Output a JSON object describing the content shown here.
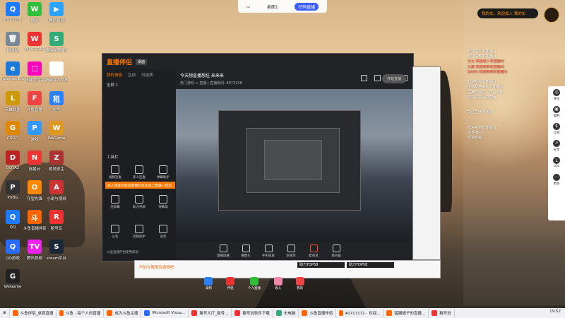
{
  "desktop": {
    "icons": [
      {
        "label": "8973158",
        "color": "#1e7bff",
        "glyph": "Q"
      },
      {
        "label": "微信",
        "color": "#2fbf3a",
        "glyph": "W"
      },
      {
        "label": "腾讯视频",
        "color": "#2ca3ff",
        "glyph": "▶"
      },
      {
        "label": "回收站",
        "color": "#7a8797",
        "glyph": "🗑"
      },
      {
        "label": "WPS 2019",
        "color": "#e33",
        "glyph": "W"
      },
      {
        "label": "搜狗视频输入法",
        "color": "#3a7",
        "glyph": "S"
      },
      {
        "label": "Internet Explorer",
        "color": "#1d7ad8",
        "glyph": "e"
      },
      {
        "label": "新建文件夹",
        "color": "#f0b",
        "glyph": "□"
      },
      {
        "label": "新建文本文档",
        "color": "#fff",
        "glyph": "≡"
      },
      {
        "label": "英雄联盟",
        "color": "#c90",
        "glyph": "L"
      },
      {
        "label": "斗鱼直播",
        "color": "#e44",
        "glyph": "F"
      },
      {
        "label": "租号",
        "color": "#2a80ff",
        "glyph": "租"
      },
      {
        "label": "CSGO",
        "color": "#d80",
        "glyph": "G"
      },
      {
        "label": "游戏",
        "color": "#39f",
        "glyph": "P"
      },
      {
        "label": "WeGame",
        "color": "#d92",
        "glyph": "W"
      },
      {
        "label": "DOTA2",
        "color": "#b22",
        "glyph": "D"
      },
      {
        "label": "网易云",
        "color": "#e33",
        "glyph": "N"
      },
      {
        "label": "绝地求生",
        "color": "#a33",
        "glyph": "Z"
      },
      {
        "label": "PUBG",
        "color": "#333",
        "glyph": "P"
      },
      {
        "label": "守望先锋",
        "color": "#f80",
        "glyph": "O"
      },
      {
        "label": "小说与视频",
        "color": "#c33",
        "glyph": "A"
      },
      {
        "label": "QQ",
        "color": "#1e7bff",
        "glyph": "Q"
      },
      {
        "label": "斗鱼直播伴侣",
        "color": "#f60",
        "glyph": "斗"
      },
      {
        "label": "租号玩",
        "color": "#e33",
        "glyph": "R"
      },
      {
        "label": "QQ游戏",
        "color": "#2a6cff",
        "glyph": "Q"
      },
      {
        "label": "腾讯视频",
        "color": "#e2e",
        "glyph": "TV"
      },
      {
        "label": "steam平台",
        "color": "#1b2838",
        "glyph": "S"
      },
      {
        "label": "WeGame",
        "color": "#222",
        "glyph": "G"
      }
    ]
  },
  "topbar": {
    "screen_label": "桌面1",
    "qr_label": "扫码直播"
  },
  "right_panel": {
    "header": "我的车，欢迎加入 我的车",
    "lines": [
      {
        "text": "欢迎进入本直播间",
        "red": false
      },
      {
        "text": "欢迎来到本直播间",
        "red": false
      },
      {
        "text": "七七 欢迎进入本直播间",
        "red": true
      },
      {
        "text": "九霄 欢迎来到本直播间",
        "red": true
      },
      {
        "text": "Smith 欢迎来到本直播间",
        "red": true
      },
      {
        "text": "",
        "red": false
      },
      {
        "text": "欢迎观看本直播间",
        "red": false
      },
      {
        "text": "主播欢迎来到本直播间",
        "red": false
      },
      {
        "text": "主播欢迎你，欢迎大家",
        "red": false
      },
      {
        "text": "欢迎你来我的直播",
        "red": false
      },
      {
        "text": "",
        "red": false
      },
      {
        "text": "",
        "red": false
      },
      {
        "text": "关注主播不迷路",
        "red": false
      },
      {
        "text": "",
        "red": false
      },
      {
        "text": "",
        "red": false
      },
      {
        "text": "欢迎来到本直播间",
        "red": false
      },
      {
        "text": "本直播间",
        "red": false
      },
      {
        "text": "欢迎观看",
        "red": false
      }
    ],
    "side": [
      {
        "label": "评论",
        "glyph": "◎"
      },
      {
        "label": "福利",
        "glyph": "▣"
      },
      {
        "label": "订阅",
        "glyph": "$"
      },
      {
        "label": "分享",
        "glyph": "↗"
      },
      {
        "label": "LOL",
        "glyph": "L"
      },
      {
        "label": "更多",
        "glyph": "⋯"
      }
    ]
  },
  "main_window": {
    "app_name": "直播伴侣",
    "tag": "桌面",
    "tabs": [
      "我的场景",
      "互动",
      "可选项"
    ],
    "scene": "全屏 1",
    "tools_title": "工具栏",
    "banner": "多人连麦开启后需要好友在线上直播一起玩",
    "tools": [
      "视频连麦",
      "多人连麦",
      "弹幕助手",
      "连屏幕",
      "助力升级",
      "弹幕墙",
      "公告",
      "流程助手",
      "语音"
    ],
    "footer": "斗鱼直播伴侣使用帮助",
    "stream_title": "今天想直播想挂 来来来",
    "stream_sub": "热门游戏 > 直播 | 直播房间: 8973158",
    "bottom_buttons": [
      "直播屏幕",
      "摄像头",
      "手机投屏",
      "多媒体",
      "麦克风",
      "扬声器"
    ],
    "start": "开始直播"
  },
  "secondary": {
    "bar_text": "不如今晚来玩游戏吧",
    "thumbs": [
      "助力TOP58",
      "助力TOP58"
    ]
  },
  "dock": [
    {
      "label": "录制",
      "color": "#2a80ff"
    },
    {
      "label": "伴侣",
      "color": "#e33"
    },
    {
      "label": "个人直播",
      "color": "#2fbf3a"
    },
    {
      "label": "收入",
      "color": "#e8a"
    },
    {
      "label": "我的",
      "color": "#e44"
    }
  ],
  "taskbar": {
    "items": [
      "斗鱼伴侣_桌面直播",
      "斗鱼 - 每个人的直播",
      "成为斗鱼主播",
      "Microsoft Visua...",
      "租号大厅_租号...",
      "租号玩软件下载",
      "击电脑",
      "斗鱼直播伴侣",
      "40717172 - 欢迎...",
      "猛腿橘子的直播...",
      "租号玩"
    ],
    "time": "19:52"
  }
}
